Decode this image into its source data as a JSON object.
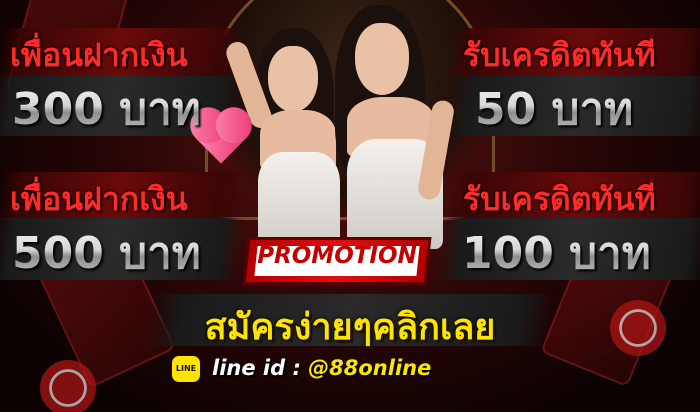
{
  "promo_left_top": {
    "title": "เพื่อนฝากเงิน",
    "amount": "300 บาท"
  },
  "promo_right_top": {
    "title": "รับเครดิตทันที",
    "amount": "50 บาท"
  },
  "promo_left_bottom": {
    "title": "เพื่อนฝากเงิน",
    "amount": "500 บาท"
  },
  "promo_right_bottom": {
    "title": "รับเครดิตทันที",
    "amount": "100 บาท"
  },
  "promotion_label": "PROMOTION",
  "register_text": "สมัครง่ายๆคลิกเลย",
  "line_icon_text": "LINE",
  "line_label": "line id : ",
  "line_handle": "@88online",
  "colors": {
    "headline_red": "#ff2a2a",
    "cta_yellow": "#ffe400",
    "promo_red": "#e01010",
    "background": "#2a0606"
  },
  "icons": [
    "heart-icon",
    "line-app-icon"
  ]
}
